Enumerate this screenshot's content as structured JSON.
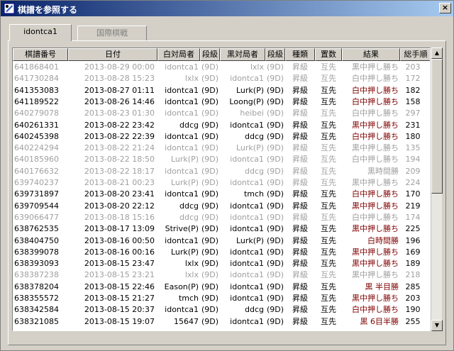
{
  "window": {
    "title": "棋譜を参照する",
    "close_glyph": "×"
  },
  "tabs": [
    {
      "label": "idontca1"
    },
    {
      "label": "国際棋戦"
    }
  ],
  "columns": [
    "棋譜番号",
    "日付",
    "白対局者",
    "段級",
    "黒対局者",
    "段級",
    "種類",
    "置数",
    "結果",
    "総手順"
  ],
  "rows": [
    {
      "id": "641868401",
      "date": "2013-08-29 00:00",
      "white": "idontca1",
      "wr": "(9D)",
      "black": "lxlx",
      "br": "(9D)",
      "type": "昇級",
      "hand": "互先",
      "result": "黒中押し勝ち",
      "moves": "203",
      "style": "gray"
    },
    {
      "id": "641730284",
      "date": "2013-08-28 15:23",
      "white": "lxlx",
      "wr": "(9D)",
      "black": "idontca1",
      "br": "(9D)",
      "type": "昇級",
      "hand": "互先",
      "result": "白中押し勝ち",
      "moves": "172",
      "style": "gray"
    },
    {
      "id": "641353083",
      "date": "2013-08-27 01:11",
      "white": "idontca1",
      "wr": "(9D)",
      "black": "Lurk(P)",
      "br": "(9D)",
      "type": "昇級",
      "hand": "互先",
      "result": "白中押し勝ち",
      "moves": "182",
      "style": "dark"
    },
    {
      "id": "641189522",
      "date": "2013-08-26 14:46",
      "white": "idontca1",
      "wr": "(9D)",
      "black": "Loong(P)",
      "br": "(9D)",
      "type": "昇級",
      "hand": "互先",
      "result": "白中押し勝ち",
      "moves": "158",
      "style": "dark"
    },
    {
      "id": "640279078",
      "date": "2013-08-23 01:30",
      "white": "idontca1",
      "wr": "(9D)",
      "black": "heibei",
      "br": "(9D)",
      "type": "昇級",
      "hand": "互先",
      "result": "白中押し勝ち",
      "moves": "297",
      "style": "gray"
    },
    {
      "id": "640261331",
      "date": "2013-08-22 23:42",
      "white": "ddcg",
      "wr": "(9D)",
      "black": "idontca1",
      "br": "(9D)",
      "type": "昇級",
      "hand": "互先",
      "result": "黒中押し勝ち",
      "moves": "231",
      "style": "dark"
    },
    {
      "id": "640245398",
      "date": "2013-08-22 22:39",
      "white": "idontca1",
      "wr": "(9D)",
      "black": "ddcg",
      "br": "(9D)",
      "type": "昇級",
      "hand": "互先",
      "result": "白中押し勝ち",
      "moves": "180",
      "style": "dark"
    },
    {
      "id": "640224294",
      "date": "2013-08-22 21:24",
      "white": "idontca1",
      "wr": "(9D)",
      "black": "Lurk(P)",
      "br": "(9D)",
      "type": "昇級",
      "hand": "互先",
      "result": "黒中押し勝ち",
      "moves": "135",
      "style": "gray"
    },
    {
      "id": "640185960",
      "date": "2013-08-22 18:50",
      "white": "Lurk(P)",
      "wr": "(9D)",
      "black": "idontca1",
      "br": "(9D)",
      "type": "昇級",
      "hand": "互先",
      "result": "白中押し勝ち",
      "moves": "194",
      "style": "gray"
    },
    {
      "id": "640176632",
      "date": "2013-08-22 18:17",
      "white": "idontca1",
      "wr": "(9D)",
      "black": "ddcg",
      "br": "(9D)",
      "type": "昇級",
      "hand": "互先",
      "result": "黒時間勝",
      "moves": "209",
      "style": "gray"
    },
    {
      "id": "639740237",
      "date": "2013-08-21 00:23",
      "white": "Lurk(P)",
      "wr": "(9D)",
      "black": "idontca1",
      "br": "(9D)",
      "type": "昇級",
      "hand": "互先",
      "result": "黒中押し勝ち",
      "moves": "224",
      "style": "gray"
    },
    {
      "id": "639731897",
      "date": "2013-08-20 23:41",
      "white": "idontca1",
      "wr": "(9D)",
      "black": "tmch",
      "br": "(9D)",
      "type": "昇級",
      "hand": "互先",
      "result": "白中押し勝ち",
      "moves": "170",
      "style": "dark"
    },
    {
      "id": "639709544",
      "date": "2013-08-20 22:12",
      "white": "ddcg",
      "wr": "(9D)",
      "black": "idontca1",
      "br": "(9D)",
      "type": "昇級",
      "hand": "互先",
      "result": "黒中押し勝ち",
      "moves": "219",
      "style": "dark"
    },
    {
      "id": "639066477",
      "date": "2013-08-18 15:16",
      "white": "ddcg",
      "wr": "(9D)",
      "black": "idontca1",
      "br": "(9D)",
      "type": "昇級",
      "hand": "互先",
      "result": "白中押し勝ち",
      "moves": "174",
      "style": "gray"
    },
    {
      "id": "638762535",
      "date": "2013-08-17 13:09",
      "white": "Strive(P)",
      "wr": "(9D)",
      "black": "idontca1",
      "br": "(9D)",
      "type": "昇級",
      "hand": "互先",
      "result": "黒中押し勝ち",
      "moves": "225",
      "style": "dark"
    },
    {
      "id": "638404750",
      "date": "2013-08-16 00:50",
      "white": "idontca1",
      "wr": "(9D)",
      "black": "Lurk(P)",
      "br": "(9D)",
      "type": "昇級",
      "hand": "互先",
      "result": "白時間勝",
      "moves": "196",
      "style": "dark"
    },
    {
      "id": "638399078",
      "date": "2013-08-16 00:16",
      "white": "Lurk(P)",
      "wr": "(9D)",
      "black": "idontca1",
      "br": "(9D)",
      "type": "昇級",
      "hand": "互先",
      "result": "黒中押し勝ち",
      "moves": "169",
      "style": "dark"
    },
    {
      "id": "638393093",
      "date": "2013-08-15 23:47",
      "white": "lxlx",
      "wr": "(9D)",
      "black": "idontca1",
      "br": "(9D)",
      "type": "昇級",
      "hand": "互先",
      "result": "黒中押し勝ち",
      "moves": "189",
      "style": "dark"
    },
    {
      "id": "638387238",
      "date": "2013-08-15 23:21",
      "white": "lxlx",
      "wr": "(9D)",
      "black": "idontca1",
      "br": "(9D)",
      "type": "昇級",
      "hand": "互先",
      "result": "黒中押し勝ち",
      "moves": "218",
      "style": "gray"
    },
    {
      "id": "638378204",
      "date": "2013-08-15 22:46",
      "white": "Eason(P)",
      "wr": "(9D)",
      "black": "idontca1",
      "br": "(9D)",
      "type": "昇級",
      "hand": "互先",
      "result": "黒 半目勝",
      "moves": "285",
      "style": "dark"
    },
    {
      "id": "638355572",
      "date": "2013-08-15 21:27",
      "white": "tmch",
      "wr": "(9D)",
      "black": "idontca1",
      "br": "(9D)",
      "type": "昇級",
      "hand": "互先",
      "result": "黒中押し勝ち",
      "moves": "203",
      "style": "dark"
    },
    {
      "id": "638342584",
      "date": "2013-08-15 20:37",
      "white": "idontca1",
      "wr": "(9D)",
      "black": "ddcg",
      "br": "(9D)",
      "type": "昇級",
      "hand": "互先",
      "result": "白中押し勝ち",
      "moves": "190",
      "style": "dark"
    },
    {
      "id": "638321085",
      "date": "2013-08-15 19:07",
      "white": "15647",
      "wr": "(9D)",
      "black": "idontca1",
      "br": "(9D)",
      "type": "昇級",
      "hand": "互先",
      "result": "黒 6目半勝",
      "moves": "255",
      "style": "dark"
    }
  ],
  "scrollbar": {
    "up_glyph": "▲",
    "down_glyph": "▼"
  }
}
